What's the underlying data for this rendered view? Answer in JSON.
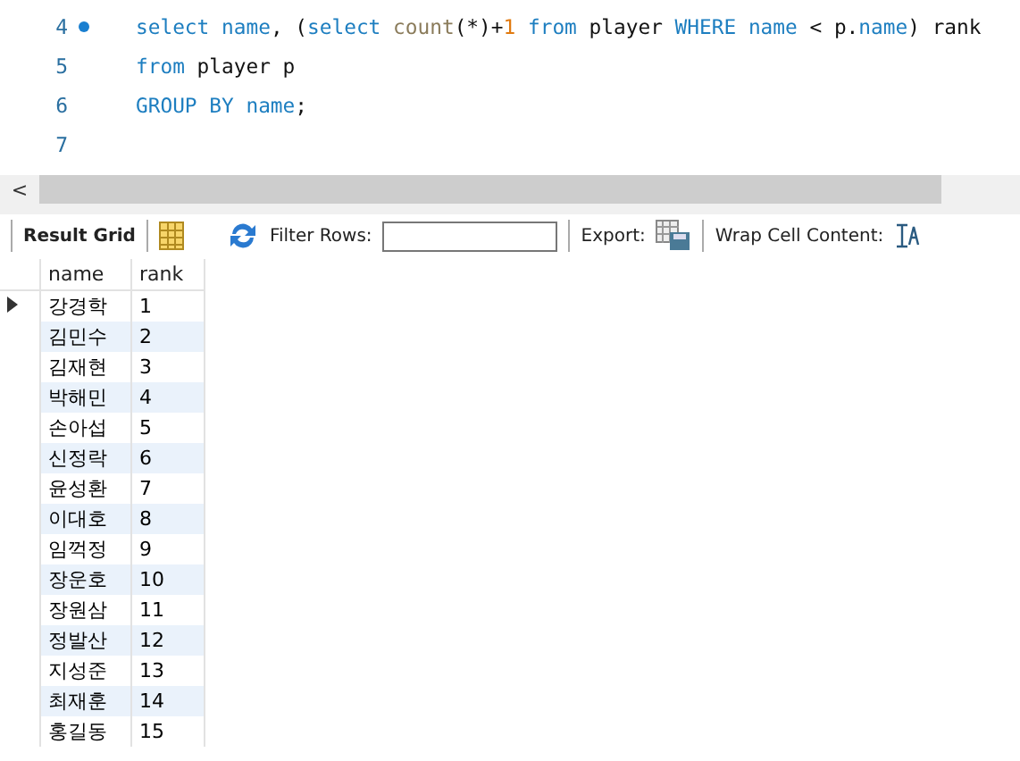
{
  "editor": {
    "lines": [
      {
        "number": "4",
        "marker": true,
        "tokens": [
          {
            "kind": "keyword",
            "text": "select name"
          },
          {
            "kind": "plain",
            "text": ", ("
          },
          {
            "kind": "keyword",
            "text": "select"
          },
          {
            "kind": "function",
            "text": " count"
          },
          {
            "kind": "plain",
            "text": "(*)+"
          },
          {
            "kind": "number",
            "text": "1"
          },
          {
            "kind": "keyword",
            "text": " from"
          },
          {
            "kind": "plain",
            "text": " player "
          },
          {
            "kind": "keyword",
            "text": "WHERE name"
          },
          {
            "kind": "plain",
            "text": " < p."
          },
          {
            "kind": "keyword",
            "text": "name"
          },
          {
            "kind": "plain",
            "text": ") rank"
          }
        ]
      },
      {
        "number": "5",
        "marker": false,
        "tokens": [
          {
            "kind": "keyword",
            "text": "from"
          },
          {
            "kind": "plain",
            "text": " player p"
          }
        ]
      },
      {
        "number": "6",
        "marker": false,
        "tokens": [
          {
            "kind": "keyword",
            "text": "GROUP BY name"
          },
          {
            "kind": "plain",
            "text": ";"
          }
        ]
      },
      {
        "number": "7",
        "marker": false
      }
    ],
    "scroll_left": "<"
  },
  "toolbar": {
    "result_grid": "Result Grid",
    "filter_label": "Filter Rows:",
    "export_label": "Export:",
    "wrap_label": "Wrap Cell Content:"
  },
  "table": {
    "columns": [
      "name",
      "rank"
    ],
    "rows": [
      {
        "cells": [
          "강경학",
          "1"
        ],
        "current": true
      },
      {
        "cells": [
          "김민수",
          "2"
        ],
        "current": false
      },
      {
        "cells": [
          "김재현",
          "3"
        ],
        "current": false
      },
      {
        "cells": [
          "박해민",
          "4"
        ],
        "current": false
      },
      {
        "cells": [
          "손아섭",
          "5"
        ],
        "current": false
      },
      {
        "cells": [
          "신정락",
          "6"
        ],
        "current": false
      },
      {
        "cells": [
          "윤성환",
          "7"
        ],
        "current": false
      },
      {
        "cells": [
          "이대호",
          "8"
        ],
        "current": false
      },
      {
        "cells": [
          "임꺽정",
          "9"
        ],
        "current": false
      },
      {
        "cells": [
          "장운호",
          "10"
        ],
        "current": false
      },
      {
        "cells": [
          "장원삼",
          "11"
        ],
        "current": false
      },
      {
        "cells": [
          "정발산",
          "12"
        ],
        "current": false
      },
      {
        "cells": [
          "지성준",
          "13"
        ],
        "current": false
      },
      {
        "cells": [
          "최재훈",
          "14"
        ],
        "current": false
      },
      {
        "cells": [
          "홍길동",
          "15"
        ],
        "current": false
      }
    ]
  }
}
